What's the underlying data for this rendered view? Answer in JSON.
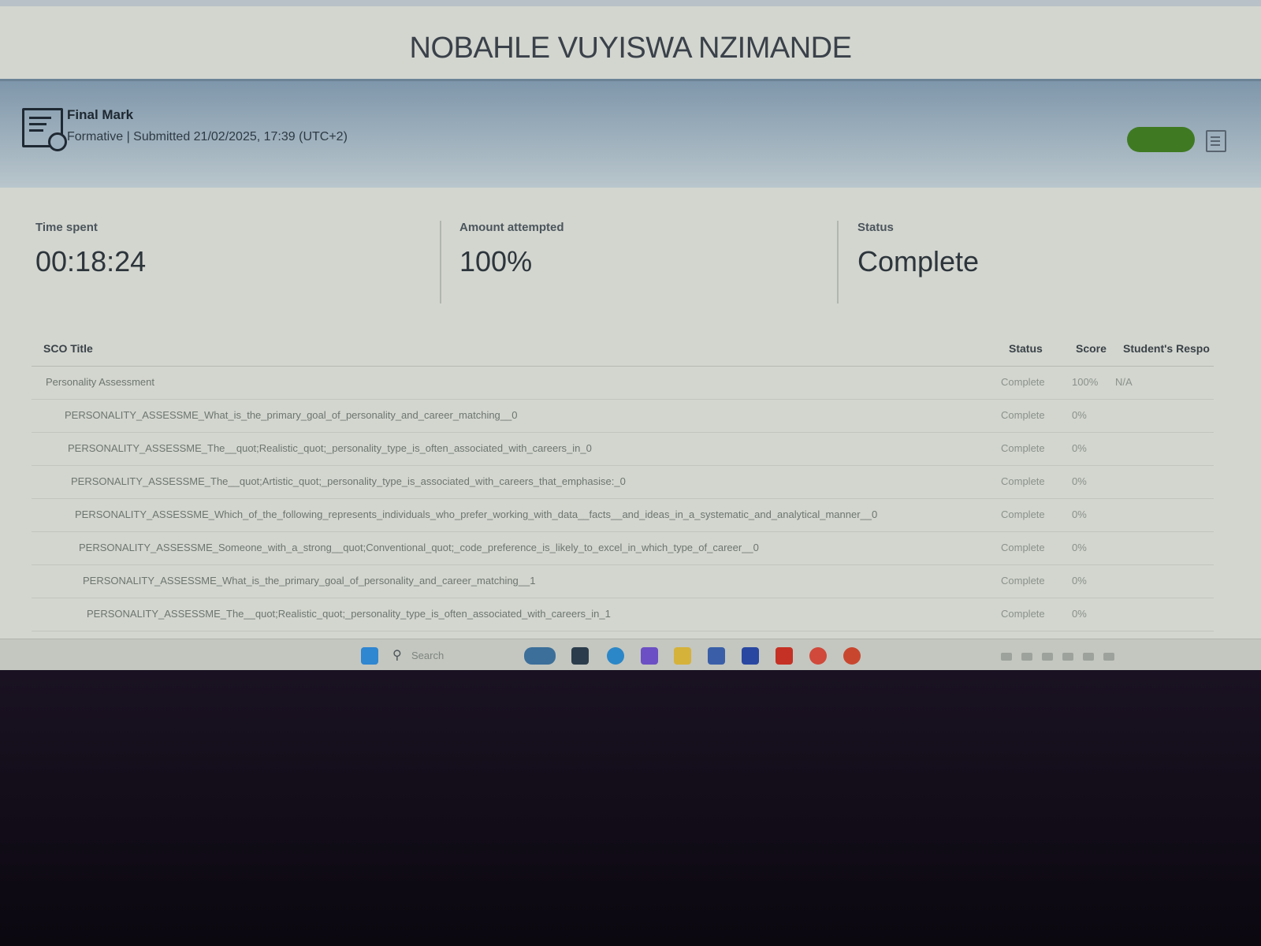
{
  "header": {
    "title": "NOBAHLE VUYISWA NZIMANDE"
  },
  "final_mark": {
    "label": "Final Mark",
    "subtitle": "Formative | Submitted 21/02/2025, 17:39 (UTC+2)",
    "icons": [
      "certificate-icon",
      "document-icon"
    ],
    "pill_color": "#3f7a22"
  },
  "stats": {
    "time_spent": {
      "label": "Time spent",
      "value": "00:18:24"
    },
    "amount_attempted": {
      "label": "Amount attempted",
      "value": "100%"
    },
    "status": {
      "label": "Status",
      "value": "Complete"
    }
  },
  "table": {
    "columns": [
      "SCO Title",
      "Status",
      "Score",
      "Student's Respo"
    ],
    "rows": [
      {
        "title": "Personality Assessment",
        "status": "Complete",
        "score": "100%",
        "response": "N/A"
      },
      {
        "title": "PERSONALITY_ASSESSME_What_is_the_primary_goal_of_personality_and_career_matching__0",
        "status": "Complete",
        "score": "0%",
        "response": ""
      },
      {
        "title": "PERSONALITY_ASSESSME_The__quot;Realistic_quot;_personality_type_is_often_associated_with_careers_in_0",
        "status": "Complete",
        "score": "0%",
        "response": ""
      },
      {
        "title": "PERSONALITY_ASSESSME_The__quot;Artistic_quot;_personality_type_is_associated_with_careers_that_emphasise:_0",
        "status": "Complete",
        "score": "0%",
        "response": ""
      },
      {
        "title": "PERSONALITY_ASSESSME_Which_of_the_following_represents_individuals_who_prefer_working_with_data__facts__and_ideas_in_a_systematic_and_analytical_manner__0",
        "status": "Complete",
        "score": "0%",
        "response": ""
      },
      {
        "title": "PERSONALITY_ASSESSME_Someone_with_a_strong__quot;Conventional_quot;_code_preference_is_likely_to_excel_in_which_type_of_career__0",
        "status": "Complete",
        "score": "0%",
        "response": ""
      },
      {
        "title": "PERSONALITY_ASSESSME_What_is_the_primary_goal_of_personality_and_career_matching__1",
        "status": "Complete",
        "score": "0%",
        "response": ""
      },
      {
        "title": "PERSONALITY_ASSESSME_The__quot;Realistic_quot;_personality_type_is_often_associated_with_careers_in_1",
        "status": "Complete",
        "score": "0%",
        "response": ""
      }
    ]
  },
  "taskbar": {
    "search_label": "Search",
    "icons": [
      "windows-start-icon",
      "search-icon",
      "widgets-icon",
      "file-explorer-icon",
      "edge-icon",
      "copilot-icon",
      "folder-icon",
      "store-icon",
      "b-app-icon",
      "youtube-icon",
      "chrome-icon",
      "powerpoint-icon"
    ]
  }
}
